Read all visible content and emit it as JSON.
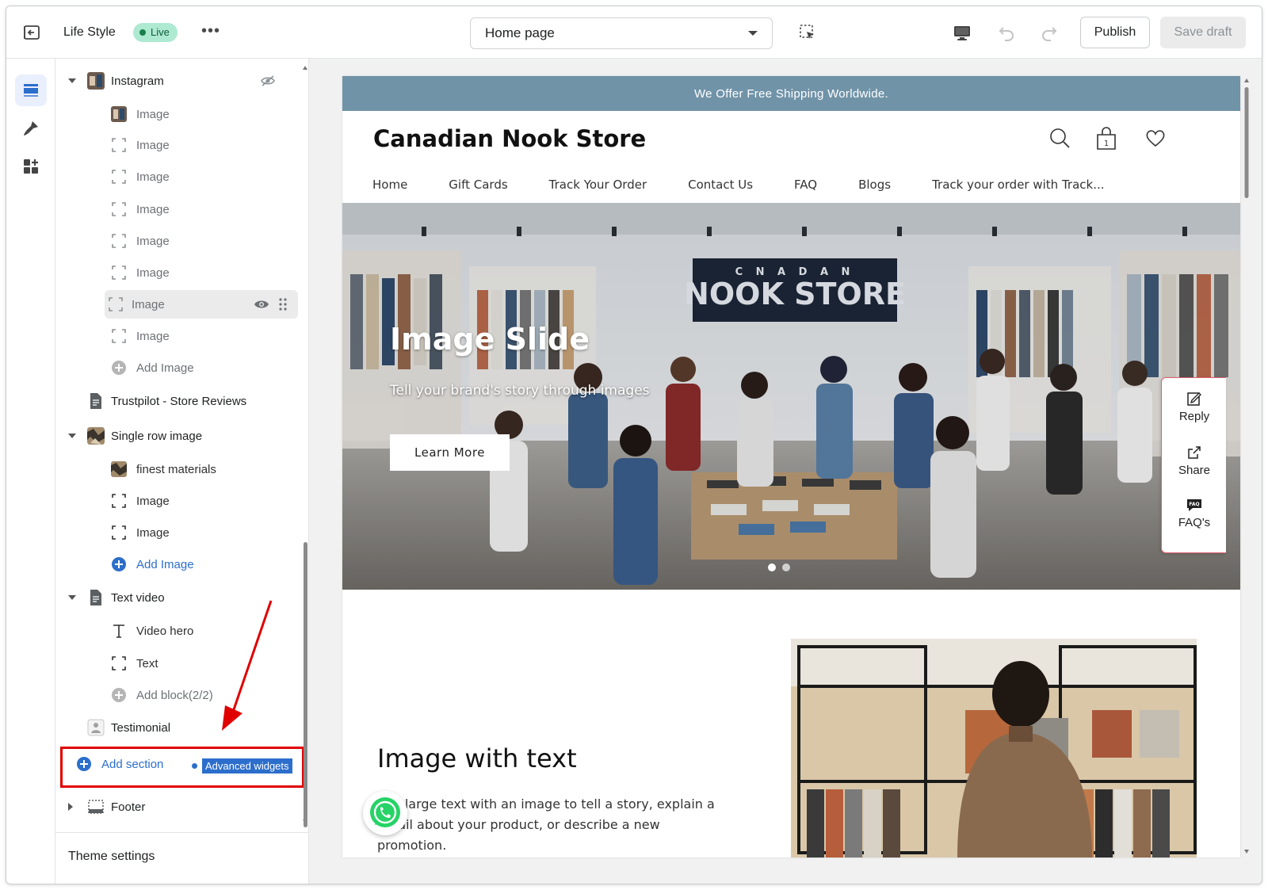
{
  "topbar": {
    "store_name": "Life Style",
    "status": "Live",
    "page_selector": "Home page",
    "publish_label": "Publish",
    "save_draft_label": "Save draft",
    "icons": [
      "exit-icon",
      "more-icon",
      "select-element-icon",
      "desktop-icon",
      "undo-icon",
      "redo-icon"
    ]
  },
  "rail": {
    "icons": [
      "sections-icon",
      "theme-brush-icon",
      "apps-icon"
    ]
  },
  "sidebar": {
    "instagram": {
      "label": "Instagram",
      "blocks": [
        "Image",
        "Image",
        "Image",
        "Image",
        "Image",
        "Image",
        "Image",
        "Image"
      ],
      "add_label": "Add Image"
    },
    "trustpilot_label": "Trustpilot - Store Reviews",
    "single_row": {
      "label": "Single row image",
      "blocks": [
        "finest materials",
        "Image",
        "Image"
      ],
      "add_label": "Add Image"
    },
    "text_video": {
      "label": "Text video",
      "blocks": [
        "Video hero",
        "Text"
      ],
      "add_label": "Add block(2/2)"
    },
    "testimonial_label": "Testimonial",
    "add_section_label": "Add section",
    "advanced_widgets_label": "Advanced widgets",
    "footer_label": "Footer",
    "theme_settings_label": "Theme settings"
  },
  "preview": {
    "announcement": "We Offer Free Shipping Worldwide.",
    "store_title": "Canadian Nook Store",
    "cart_count": "1",
    "nav": [
      "Home",
      "Gift Cards",
      "Track Your Order",
      "Contact Us",
      "FAQ",
      "Blogs",
      "Track your order with Track..."
    ],
    "hero": {
      "sign_small": "C N A D A N",
      "sign_big": "NOOK STORE",
      "title": "Image Slide",
      "subtitle": "Tell your brand's story through images",
      "button": "Learn More",
      "slides": 2,
      "active_slide": 1
    },
    "side_panel": [
      "Reply",
      "Share",
      "FAQ's"
    ],
    "image_with_text": {
      "title": "Image with text",
      "body": "Pair large text with an image to tell a story, explain a detail about your product, or describe a new promotion."
    }
  },
  "colors": {
    "accent": "#2c6ecb",
    "announcement_bg": "#7093a8",
    "live_badge_bg": "#aee9d1",
    "highlight_red": "#e00000"
  }
}
